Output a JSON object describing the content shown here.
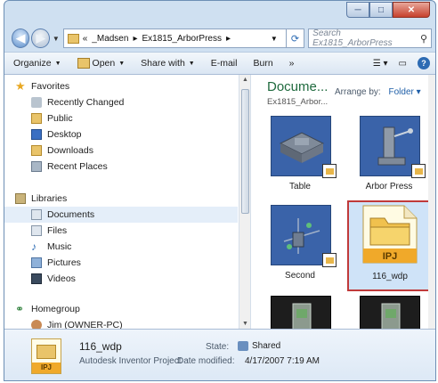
{
  "window": {
    "caption_min": "─",
    "caption_max": "□",
    "caption_close": "✕"
  },
  "address_bar": {
    "crumbs": [
      "«",
      "_Madsen",
      "▸",
      "Ex1815_ArborPress",
      "▸"
    ],
    "search_placeholder": "Search Ex1815_ArborPress"
  },
  "toolbar": {
    "organize": "Organize",
    "open": "Open",
    "share_with": "Share with",
    "email": "E-mail",
    "burn": "Burn",
    "more": "»"
  },
  "nav": {
    "favorites_header": "Favorites",
    "favorites": [
      "Recently Changed",
      "Public",
      "Desktop",
      "Downloads",
      "Recent Places"
    ],
    "libraries_header": "Libraries",
    "libraries": [
      "Documents",
      "Files",
      "Music",
      "Pictures",
      "Videos"
    ],
    "homegroup_header": "Homegroup",
    "homegroup_items": [
      "Jim (OWNER-PC)"
    ]
  },
  "content": {
    "library_title": "Docume...",
    "library_subtitle": "Ex1815_Arbor...",
    "arrange_label": "Arrange by:",
    "arrange_value": "Folder",
    "tiles": [
      {
        "label": "Table"
      },
      {
        "label": "Arbor Press"
      },
      {
        "label": "Second"
      },
      {
        "label": "116_wdp"
      },
      {
        "label": ""
      },
      {
        "label": ""
      }
    ],
    "ipj_icon_text": "IPJ"
  },
  "details": {
    "name": "116_wdp",
    "type": "Autodesk Inventor Project",
    "state_label": "State:",
    "state_value": "Shared",
    "date_label": "Date modified:",
    "date_value": "4/17/2007 7:19 AM",
    "icon_text": "IPJ"
  },
  "colors": {
    "selected_outline": "#c03a3a",
    "library_title": "#1f6a3e",
    "model_bg": "#3a63a9"
  }
}
